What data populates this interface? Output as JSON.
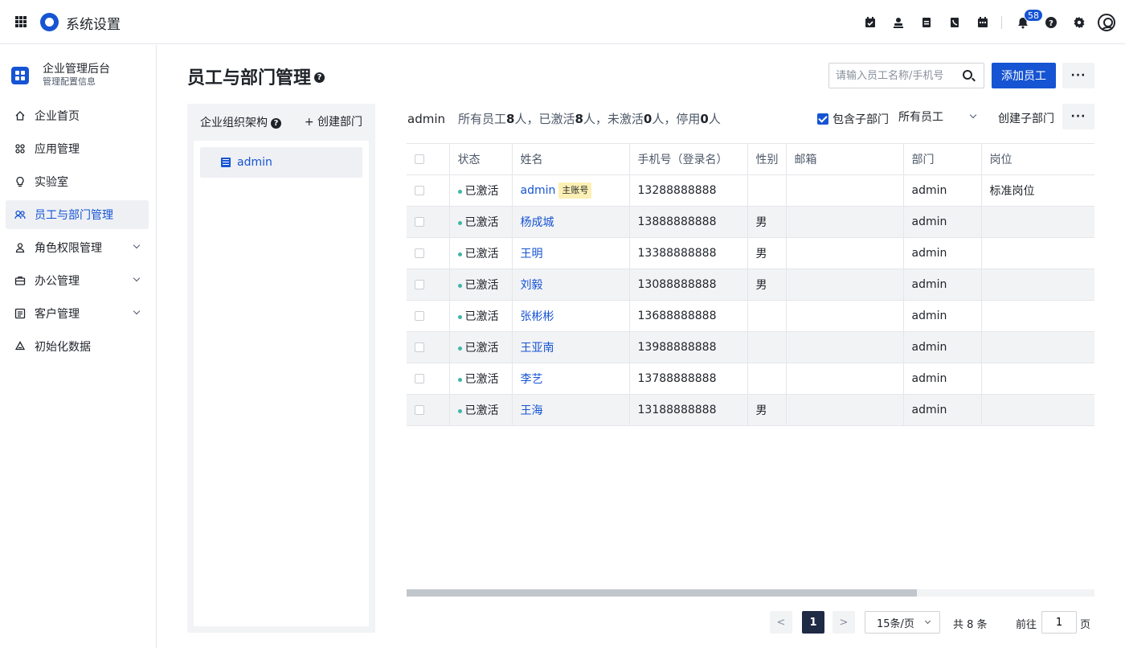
{
  "app": {
    "title": "系统设置"
  },
  "topbar": {
    "notification_count": "58"
  },
  "sidebar": {
    "title": "企业管理后台",
    "subtitle": "管理配置信息",
    "items": [
      {
        "label": "企业首页"
      },
      {
        "label": "应用管理"
      },
      {
        "label": "实验室"
      },
      {
        "label": "员工与部门管理"
      },
      {
        "label": "角色权限管理"
      },
      {
        "label": "办公管理"
      },
      {
        "label": "客户管理"
      },
      {
        "label": "初始化数据"
      }
    ]
  },
  "page": {
    "title": "员工与部门管理",
    "search_placeholder": "请输入员工名称/手机号",
    "add_button": "添加员工",
    "more": "···"
  },
  "org": {
    "heading": "企业组织架构",
    "create": "+ 创建部门",
    "node": "admin"
  },
  "summary": {
    "dept": "admin",
    "p1": "所有员工",
    "total": "8",
    "p2": "人，已激活",
    "active": "8",
    "p3": "人，未激活",
    "inactive": "0",
    "p4": "人，停用",
    "disabled": "0",
    "p5": "人",
    "include_sub": "包含子部门",
    "filter": "所有员工",
    "create_sub": "创建子部门"
  },
  "table": {
    "headers": [
      "状态",
      "姓名",
      "手机号（登录名）",
      "性别",
      "邮箱",
      "部门",
      "岗位"
    ],
    "rows": [
      {
        "status": "已激活",
        "name": "admin",
        "tag": "主账号",
        "phone": "13288888888",
        "gender": "",
        "email": "",
        "dept": "admin",
        "post": "标准岗位"
      },
      {
        "status": "已激活",
        "name": "杨成城",
        "phone": "13888888888",
        "gender": "男",
        "email": "",
        "dept": "admin",
        "post": ""
      },
      {
        "status": "已激活",
        "name": "王明",
        "phone": "13388888888",
        "gender": "男",
        "email": "",
        "dept": "admin",
        "post": ""
      },
      {
        "status": "已激活",
        "name": "刘毅",
        "phone": "13088888888",
        "gender": "男",
        "email": "",
        "dept": "admin",
        "post": ""
      },
      {
        "status": "已激活",
        "name": "张彬彬",
        "phone": "13688888888",
        "gender": "",
        "email": "",
        "dept": "admin",
        "post": ""
      },
      {
        "status": "已激活",
        "name": "王亚南",
        "phone": "13988888888",
        "gender": "",
        "email": "",
        "dept": "admin",
        "post": ""
      },
      {
        "status": "已激活",
        "name": "李艺",
        "phone": "13788888888",
        "gender": "",
        "email": "",
        "dept": "admin",
        "post": ""
      },
      {
        "status": "已激活",
        "name": "王海",
        "phone": "13188888888",
        "gender": "男",
        "email": "",
        "dept": "admin",
        "post": ""
      }
    ]
  },
  "pagination": {
    "prev": "<",
    "current": "1",
    "next": ">",
    "page_size": "15条/页",
    "total": "共 8 条",
    "goto": "前往",
    "goto_value": "1",
    "page_suffix": "页"
  },
  "colors": {
    "primary": "#1654d3",
    "active_dot": "#3fb6a8",
    "tag_bg": "#fdf0b4"
  },
  "icons": [
    "apps-grid-icon",
    "logo-icon",
    "calendar-check-icon",
    "user-stamp-icon",
    "document-icon",
    "phone-icon",
    "calendar-icon",
    "bell-icon",
    "help-icon",
    "settings-icon",
    "avatar-icon"
  ]
}
